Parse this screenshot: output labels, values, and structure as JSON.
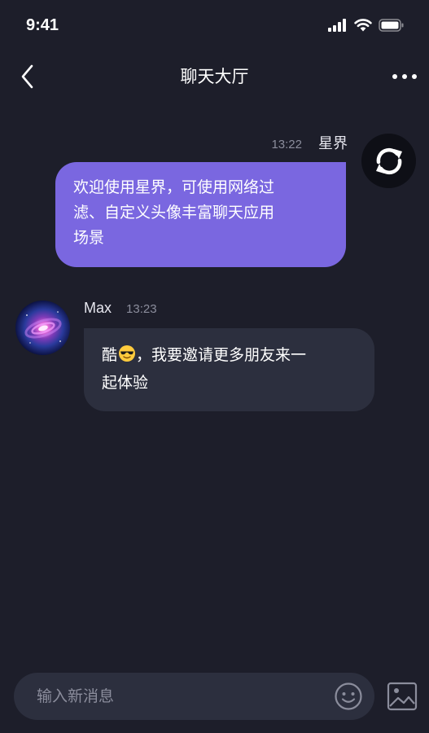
{
  "status_bar": {
    "time": "9:41"
  },
  "nav": {
    "title": "聊天大厅",
    "back_icon": "chevron-left-icon",
    "more_icon": "more-horizontal-icon"
  },
  "messages": [
    {
      "direction": "outgoing",
      "sender": "星界",
      "time": "13:22",
      "avatar_icon": "sync-icon",
      "lines": [
        "欢迎使用星界，可使用网络过",
        "滤、自定义头像丰富聊天应用",
        "场景"
      ]
    },
    {
      "direction": "incoming",
      "sender": "Max",
      "time": "13:23",
      "avatar_image": "galaxy-avatar",
      "line1_pre": "酷",
      "emoji": "sunglasses-emoji",
      "line1_post": "，我要邀请更多朋友来一",
      "line2": "起体验"
    }
  ],
  "composer": {
    "placeholder": "输入新消息",
    "value": "",
    "emoji_icon": "smiley-icon",
    "image_icon": "image-icon"
  },
  "colors": {
    "background": "#1d1e2a",
    "outgoing_bubble": "#7a67e0",
    "incoming_bubble": "#2c2f3e",
    "muted_text": "#8b8d9c"
  }
}
